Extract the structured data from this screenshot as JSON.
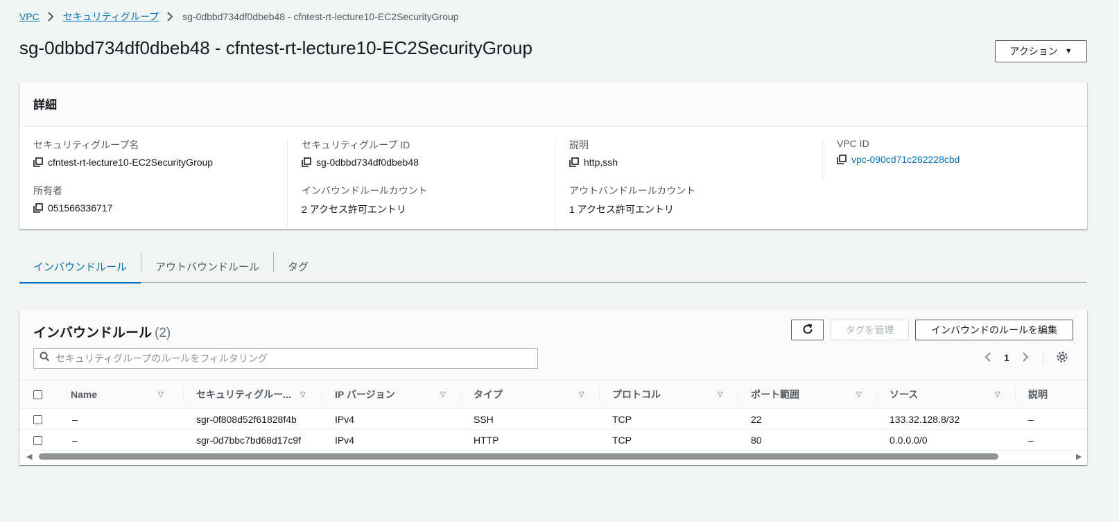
{
  "breadcrumb": {
    "vpc": "VPC",
    "security_groups": "セキュリティグループ",
    "current": "sg-0dbbd734df0dbeb48 - cfntest-rt-lecture10-EC2SecurityGroup"
  },
  "page_title": "sg-0dbbd734df0dbeb48 - cfntest-rt-lecture10-EC2SecurityGroup",
  "actions_label": "アクション",
  "details": {
    "header": "詳細",
    "sg_name_label": "セキュリティグループ名",
    "sg_name_value": "cfntest-rt-lecture10-EC2SecurityGroup",
    "sg_id_label": "セキュリティグループ ID",
    "sg_id_value": "sg-0dbbd734df0dbeb48",
    "description_label": "説明",
    "description_value": "http,ssh",
    "vpc_id_label": "VPC ID",
    "vpc_id_value": "vpc-090cd71c262228cbd",
    "owner_label": "所有者",
    "owner_value": "051566336717",
    "inbound_count_label": "インバウンドルールカウント",
    "inbound_count_value": "2 アクセス許可エントリ",
    "outbound_count_label": "アウトバンドルールカウント",
    "outbound_count_value": "1 アクセス許可エントリ"
  },
  "tabs": [
    {
      "label": "インバウンドルール"
    },
    {
      "label": "アウトバウンドルール"
    },
    {
      "label": "タグ"
    }
  ],
  "rules": {
    "title": "インバウンドルール",
    "count": "(2)",
    "manage_tags": "タグを管理",
    "edit_rules": "インバウンドのルールを編集",
    "search_placeholder": "セキュリティグループのルールをフィルタリング",
    "page": "1",
    "columns": [
      "Name",
      "セキュリティグルー...",
      "IP バージョン",
      "タイプ",
      "プロトコル",
      "ポート範囲",
      "ソース",
      "説明"
    ],
    "rows": [
      {
        "name": "–",
        "sgr": "sgr-0f808d52f61828f4b",
        "ip": "IPv4",
        "type": "SSH",
        "protocol": "TCP",
        "port": "22",
        "source": "133.32.128.8/32",
        "desc": "–"
      },
      {
        "name": "–",
        "sgr": "sgr-0d7bbc7bd68d17c9f",
        "ip": "IPv4",
        "type": "HTTP",
        "protocol": "TCP",
        "port": "80",
        "source": "0.0.0.0/0",
        "desc": "–"
      }
    ]
  },
  "icons": [
    "chevron-right-icon",
    "copy-icon",
    "refresh-icon",
    "search-icon",
    "chevron-left-icon",
    "gear-icon",
    "caret-down-icon",
    "checkbox"
  ],
  "colors": {
    "link": "#0073bb",
    "text": "#16191f",
    "secondary": "#545b64",
    "background": "#f2f3f3"
  }
}
